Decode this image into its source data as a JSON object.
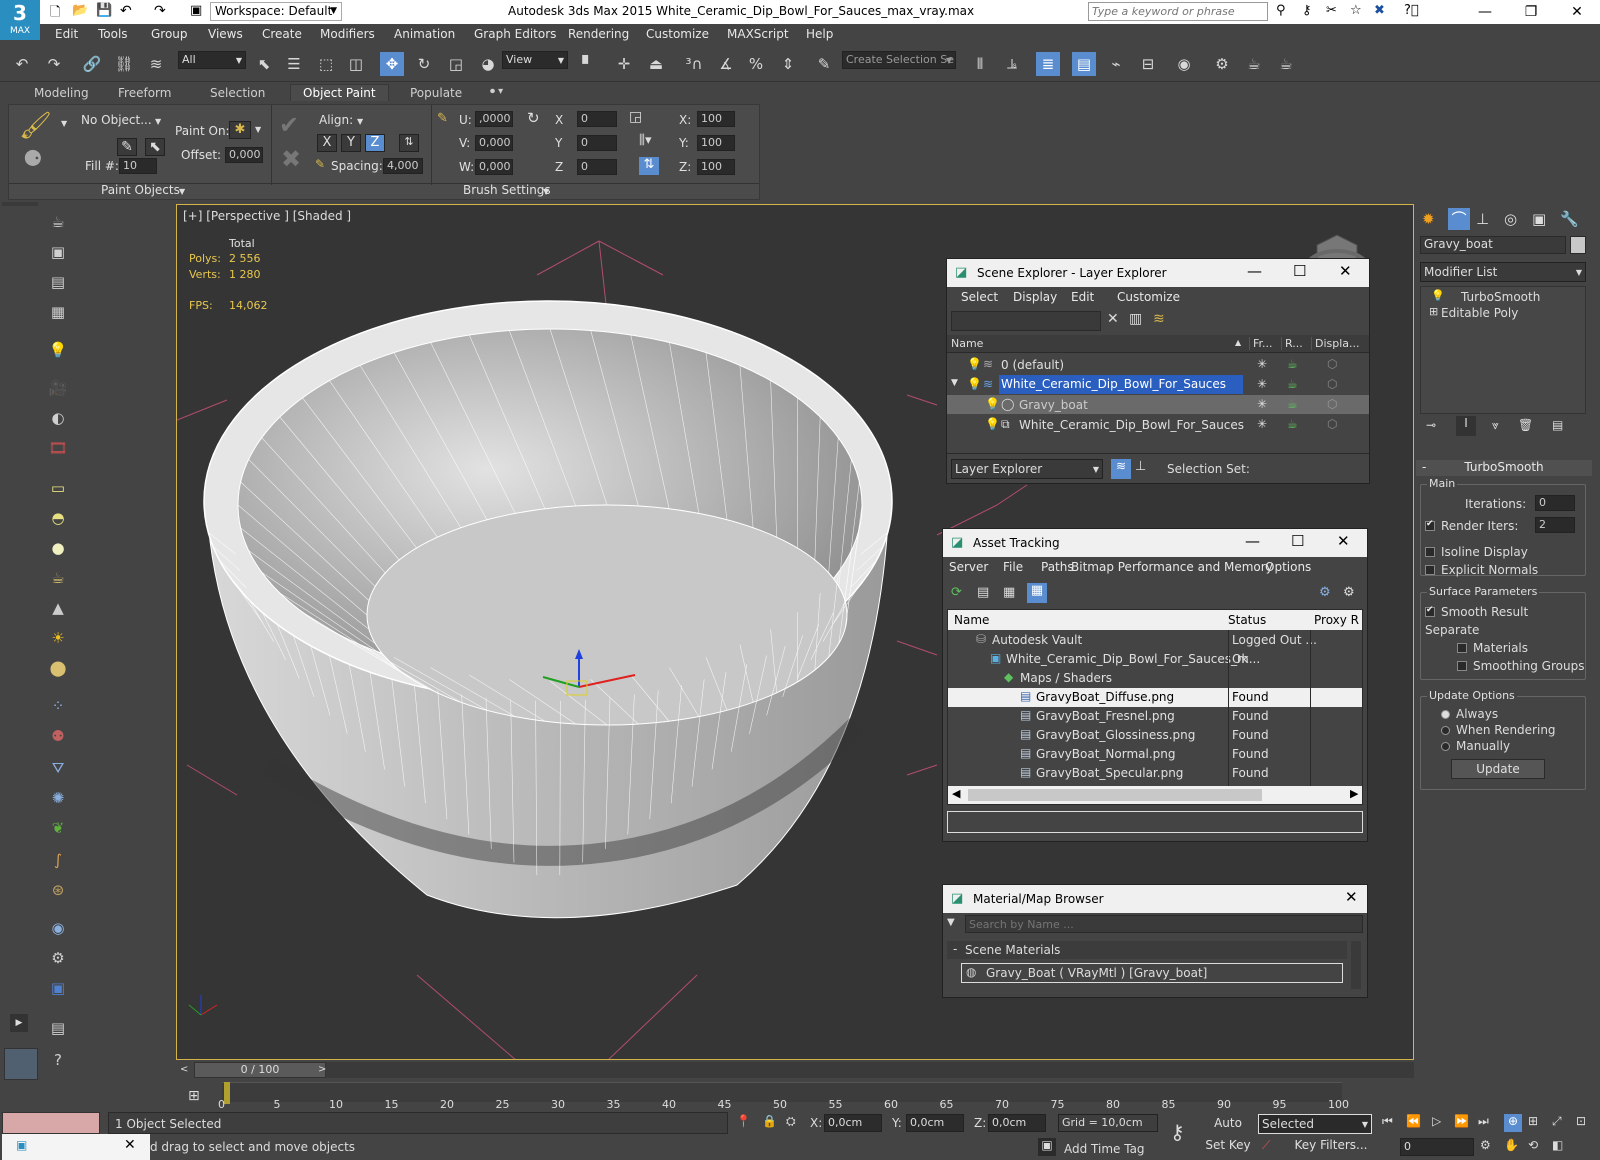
{
  "app": {
    "title": "Autodesk 3ds Max  2015    White_Ceramic_Dip_Bowl_For_Sauces_max_vray.max",
    "logo_text": "MAX",
    "workspace": "Workspace: Default",
    "search_placeholder": "Type a keyword or phrase"
  },
  "menu": [
    "Edit",
    "Tools",
    "Group",
    "Views",
    "Create",
    "Modifiers",
    "Animation",
    "Graph Editors",
    "Rendering",
    "Customize",
    "MAXScript",
    "Help"
  ],
  "toolbar": {
    "filter": "All",
    "ref_coord": "View",
    "named_selection": "Create Selection Se"
  },
  "ribbon": {
    "tabs": [
      "Modeling",
      "Freeform",
      "Selection",
      "Object Paint",
      "Populate"
    ],
    "active_tab": "Object Paint",
    "no_object": "No Object...",
    "paint_on": "Paint On:",
    "offset_label": "Offset:",
    "offset_value": "0,000",
    "fill_label": "Fill #:",
    "fill_value": "10",
    "align_label": "Align:",
    "axes": [
      "X",
      "Y",
      "Z"
    ],
    "spacing_label": "Spacing:",
    "spacing_value": "4,000",
    "u_label": "U:",
    "u_value": ",0000",
    "v_label": "V:",
    "v_value": "0,000",
    "w_label": "W:",
    "w_value": "0,000",
    "rx_label": "X",
    "rx_value": "0",
    "ry_label": "Y",
    "ry_value": "0",
    "rz_label": "Z",
    "rz_value": "0",
    "sx_label": "X:",
    "sx_value": "100",
    "sy_label": "Y:",
    "sy_value": "100",
    "sz_label": "Z:",
    "sz_value": "100",
    "group1": "Paint Objects",
    "group2": "Brush Settings"
  },
  "viewport": {
    "label": "[+] [Perspective ] [Shaded ]",
    "total": "Total",
    "polys_label": "Polys:",
    "polys_value": "2 556",
    "verts_label": "Verts:",
    "verts_value": "1 280",
    "fps_label": "FPS:",
    "fps_value": "14,062"
  },
  "scene_explorer": {
    "title": "Scene Explorer - Layer Explorer",
    "menu": [
      "Select",
      "Display",
      "Edit",
      "Customize"
    ],
    "columns": [
      "Name",
      "Fr...",
      "R...",
      "Displa..."
    ],
    "rows": [
      "0 (default)",
      "White_Ceramic_Dip_Bowl_For_Sauces",
      "Gravy_boat",
      "White_Ceramic_Dip_Bowl_For_Sauces"
    ],
    "footer_mode": "Layer Explorer",
    "selection_set": "Selection Set:"
  },
  "asset_tracking": {
    "title": "Asset Tracking",
    "menu": [
      "Server",
      "File",
      "Paths",
      "Bitmap Performance and Memory",
      "Options"
    ],
    "columns": [
      "Name",
      "Status",
      "Proxy R"
    ],
    "rows": [
      {
        "name": "Autodesk Vault",
        "status": "Logged Out ..."
      },
      {
        "name": "White_Ceramic_Dip_Bowl_For_Sauces_m...",
        "status": "Ok"
      },
      {
        "name": "Maps / Shaders",
        "status": ""
      },
      {
        "name": "GravyBoat_Diffuse.png",
        "status": "Found"
      },
      {
        "name": "GravyBoat_Fresnel.png",
        "status": "Found"
      },
      {
        "name": "GravyBoat_Glossiness.png",
        "status": "Found"
      },
      {
        "name": "GravyBoat_Normal.png",
        "status": "Found"
      },
      {
        "name": "GravyBoat_Specular.png",
        "status": "Found"
      }
    ]
  },
  "material_browser": {
    "title": "Material/Map Browser",
    "search_placeholder": "Search by Name ...",
    "section": "Scene Materials",
    "item": "Gravy_Boat  ( VRayMtl )  [Gravy_boat]"
  },
  "command_panel": {
    "object_name": "Gravy_boat",
    "modifier_list": "Modifier List",
    "stack": [
      "TurboSmooth",
      "Editable Poly"
    ],
    "rollout_title": "TurboSmooth",
    "main_group": "Main",
    "iterations_label": "Iterations:",
    "iterations_value": "0",
    "render_iters_label": "Render Iters:",
    "render_iters_value": "2",
    "isoline": "Isoline Display",
    "explicit_normals": "Explicit Normals",
    "surface_group": "Surface Parameters",
    "smooth_result": "Smooth Result",
    "separate": "Separate",
    "materials": "Materials",
    "smoothing_groups": "Smoothing Groups",
    "update_group": "Update Options",
    "always": "Always",
    "when_rendering": "When Rendering",
    "manually": "Manually",
    "update_button": "Update"
  },
  "timeline": {
    "frame": "0 / 100",
    "ticks": [
      "0",
      "5",
      "10",
      "15",
      "20",
      "25",
      "30",
      "35",
      "40",
      "45",
      "50",
      "55",
      "60",
      "65",
      "70",
      "75",
      "80",
      "85",
      "90",
      "95",
      "100"
    ]
  },
  "status": {
    "selected": "1 Object Selected",
    "prompt": "d drag to select and move objects",
    "x_label": "X:",
    "x_value": "0,0cm",
    "y_label": "Y:",
    "y_value": "0,0cm",
    "z_label": "Z:",
    "z_value": "0,0cm",
    "grid": "Grid = 10,0cm",
    "add_time_tag": "Add Time Tag",
    "auto_key": "Auto Key",
    "set_key": "Set Key",
    "key_mode": "Selected",
    "key_filters": "Key Filters...",
    "frame_value": "0"
  }
}
